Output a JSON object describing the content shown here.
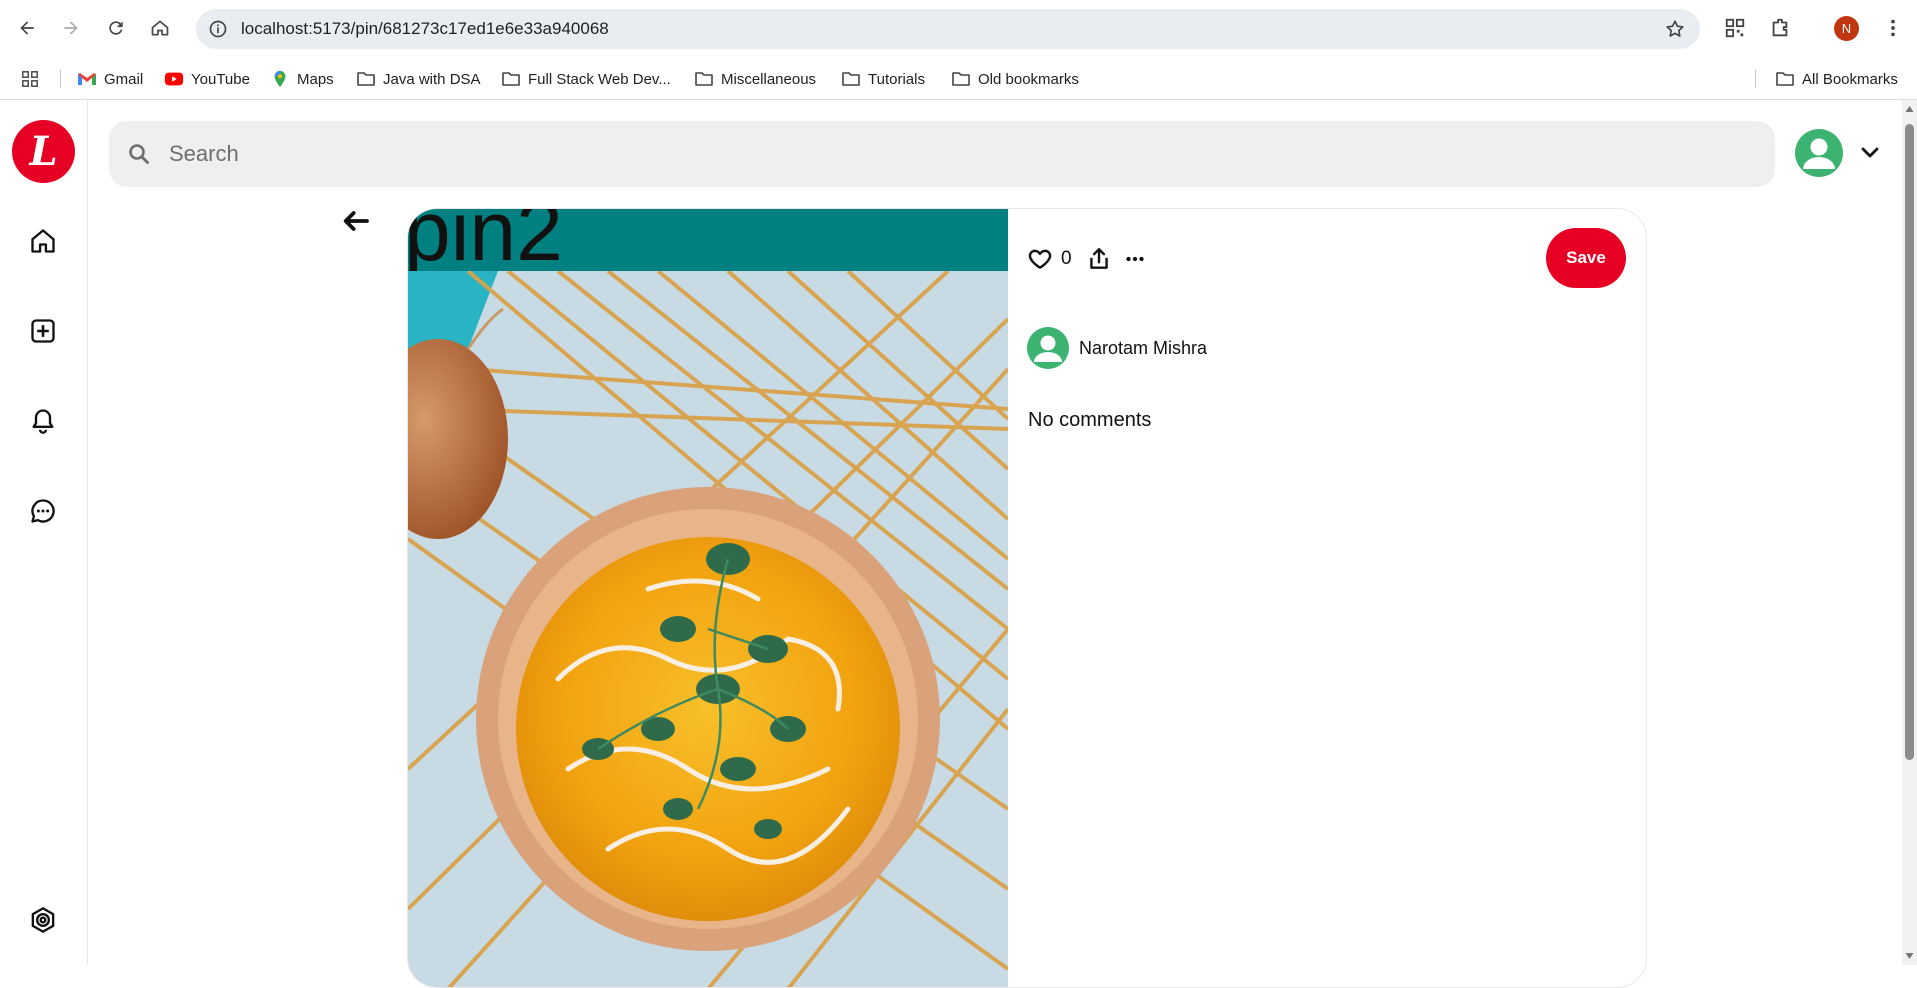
{
  "browser": {
    "url": "localhost:5173/pin/681273c17ed1e6e33a940068",
    "profile_initial": "N",
    "bookmarks": [
      {
        "label": "Gmail",
        "icon": "gmail-icon"
      },
      {
        "label": "YouTube",
        "icon": "youtube-icon"
      },
      {
        "label": "Maps",
        "icon": "maps-icon"
      },
      {
        "label": "Java with DSA",
        "icon": "folder-icon"
      },
      {
        "label": "Full Stack Web Dev...",
        "icon": "folder-icon"
      },
      {
        "label": "Miscellaneous",
        "icon": "folder-icon"
      },
      {
        "label": "Tutorials",
        "icon": "folder-icon"
      },
      {
        "label": "Old bookmarks",
        "icon": "folder-icon"
      }
    ],
    "all_bookmarks": "All Bookmarks"
  },
  "app": {
    "logo_letter": "L",
    "brand_color": "#e60023",
    "search_placeholder": "Search",
    "sidebar_icons": [
      "home-icon",
      "create-icon",
      "notifications-icon",
      "messages-icon",
      "settings-icon"
    ]
  },
  "pin": {
    "image_title": "pin2",
    "band_color": "#008080",
    "like_count": "0",
    "save_label": "Save",
    "author": "Narotam Mishra",
    "comments_text": "No comments"
  }
}
